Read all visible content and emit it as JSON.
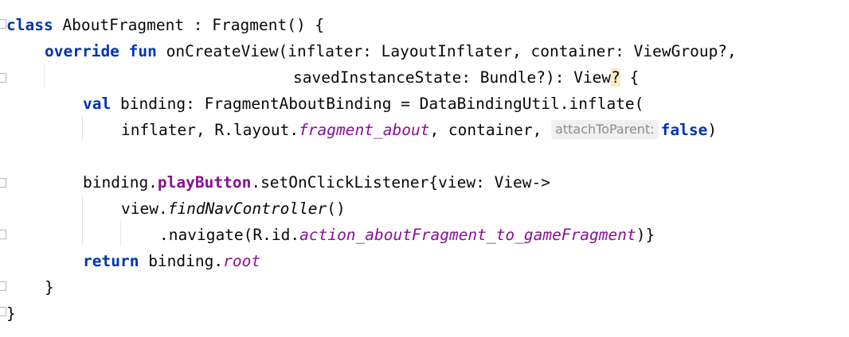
{
  "code": {
    "l1": {
      "kw": "class",
      "rest": " AboutFragment : Fragment() {"
    },
    "l2": {
      "kw1": "override",
      "kw2": "fun",
      "rest": " onCreateView(inflater: LayoutInflater, container: ViewGroup?,"
    },
    "l3": {
      "text": "savedInstanceState: Bundle?): View",
      "q": "?",
      "tail": " {"
    },
    "l4": {
      "kw": "val",
      "rest": " binding: FragmentAboutBinding = DataBindingUtil.inflate("
    },
    "l5": {
      "pre": "inflater, R.layout.",
      "ital": "fragment_about",
      "mid": ", container, ",
      "hint": "attachToParent:",
      "kw": "false",
      "tail": ")"
    },
    "l7": {
      "pre": "binding.",
      "prop": "playButton",
      "rest": ".setOnClickListener{view: View->"
    },
    "l8": {
      "pre": "view.",
      "fn": "findNavController",
      "tail": "()"
    },
    "l9": {
      "pre": ".navigate(R.id.",
      "ital": "action_aboutFragment_to_gameFragment",
      "tail": ")}"
    },
    "l10": {
      "kw": "return",
      "pre": " binding.",
      "ital": "root"
    },
    "l11": {
      "text": "}"
    },
    "l12": {
      "text": "}"
    }
  }
}
